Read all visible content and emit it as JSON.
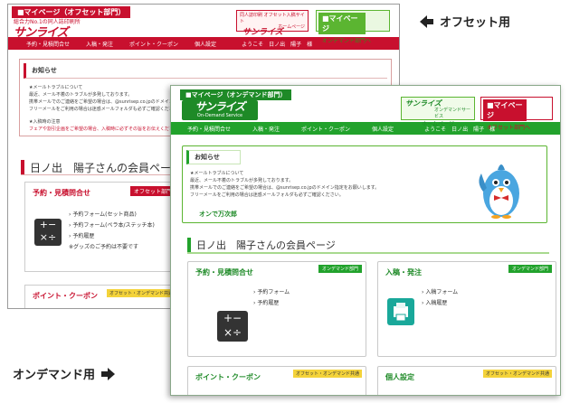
{
  "labels": {
    "offset": "オフセット用",
    "ondemand": "オンデマンド用"
  },
  "offset": {
    "tag": "■マイページ（オフセット部門）",
    "subtitle": "総合力No.1の同人誌印刷所",
    "logo": "サンライズ",
    "home_button": {
      "top": "同人誌印刷 オフセット入稿サイト",
      "main": "サンライズ",
      "bottom": "ホームページ"
    },
    "mypage_button": {
      "main": "■マイページ",
      "bottom": "オンデマンド部門へ"
    },
    "nav": [
      "予約・見積問合せ",
      "入稿・発注",
      "ポイント・クーポン",
      "個人設定"
    ],
    "greeting": "ようこそ　日ノ出　陽子　様",
    "notice": {
      "title": "お知らせ",
      "heading": "★メールトラブルについて",
      "lines": [
        "最近、メール不着のトラブルが多発しております。",
        "携帯メールでのご連絡をご希望の場合は、@sunrisep.co.jpのドメイン指定をお願いします。",
        "フリーメールをご利用の場合は迷惑メールフォルダも必ずご確認ください。"
      ],
      "heading2": "★入稿時の注意",
      "lines2": [
        "フェアや割引企画をご希望の場合、入稿時に必ずその旨をお伝えください。"
      ]
    },
    "member_title": "日ノ出　陽子さんの会員ページ",
    "card1": {
      "title": "予約・見積問合せ",
      "badge": "オフセット部門",
      "links": [
        "予約フォーム(セット商品)",
        "予約フォーム(ペラ本/ステッチ本)",
        "予約履歴",
        "※グッズのご予約は不要です"
      ]
    },
    "card2": {
      "title": "ポイント・クーポン",
      "badge": "オフセット・オンデマンド共通"
    }
  },
  "ondemand": {
    "tag": "■マイページ（オンデマンド部門）",
    "logo_main": "サンライズ",
    "logo_sub": "On-Demand Service",
    "home_button": {
      "main": "サンライズ",
      "sub": "オンデマンドサービス",
      "bottom": "ホームページ"
    },
    "mypage_button": {
      "main": "■マイページ",
      "bottom": "オフセット部門へ"
    },
    "nav": [
      "予約・見積問合せ",
      "入稿・発注",
      "ポイント・クーポン",
      "個人設定"
    ],
    "greeting": "ようこそ　日ノ出　陽子　様",
    "notice": {
      "title": "お知らせ",
      "heading": "★メールトラブルについて",
      "lines": [
        "最近、メール不着のトラブルが多発しております。",
        "携帯メールでのご連絡をご希望の場合は、@sunrisep.co.jpのドメイン指定をお願いします。",
        "フリーメールをご利用の場合は迷惑メールフォルダも必ずご確認ください。"
      ],
      "signature": "オンで万次郎"
    },
    "member_title": "日ノ出　陽子さんの会員ページ",
    "card_reserve": {
      "title": "予約・見積問合せ",
      "badge": "オンデマンド部門",
      "links": [
        "予約フォーム",
        "予約履歴"
      ]
    },
    "card_order": {
      "title": "入稿・発注",
      "badge": "オンデマンド部門",
      "links": [
        "入稿フォーム",
        "入稿履歴"
      ]
    },
    "card_point": {
      "title": "ポイント・クーポン",
      "badge": "オフセット・オンデマンド共通"
    },
    "card_settings": {
      "title": "個人設定",
      "badge": "オフセット・オンデマンド共通"
    }
  },
  "colors": {
    "offset_red": "#c8102e",
    "ondemand_green": "#22a22c"
  },
  "icons": [
    "calculator-icon",
    "printer-icon",
    "bird-mascot-icon",
    "arrow-left-icon",
    "arrow-right-icon"
  ]
}
